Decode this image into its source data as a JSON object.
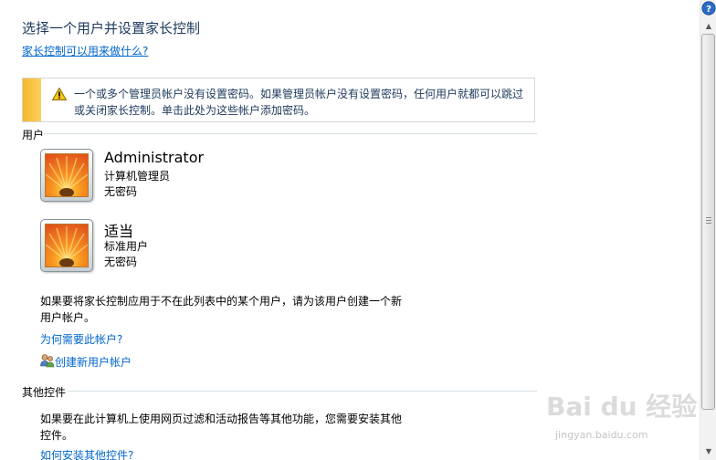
{
  "page": {
    "title": "选择一个用户并设置家长控制",
    "help_link": "家长控制可以用来做什么?"
  },
  "warning": {
    "line1": "一个或多个管理员帐户没有设置密码。如果管理员帐户没有设置密码，任何用户就都可以跳过",
    "line2": "或关闭家长控制。单击此处为这些帐户添加密码。",
    "icon": "warning-icon"
  },
  "users_section": {
    "label": "用户",
    "users": [
      {
        "name": "Administrator",
        "role": "计算机管理员",
        "password": "无密码"
      },
      {
        "name": "适当",
        "role": "标准用户",
        "password": "无密码"
      }
    ]
  },
  "info": {
    "line1": "如果要将家长控制应用于不在此列表中的某个用户，请为该用户创建一个新",
    "line2": "用户帐户。",
    "why_link": "为何需要此帐户?",
    "create_link": "创建新用户帐户"
  },
  "other_section": {
    "label": "其他控件",
    "line1": "如果要在此计算机上使用网页过滤和活动报告等其他功能，您需要安装其他",
    "line2": "控件。",
    "install_link": "如何安装其他控件?"
  },
  "watermark": {
    "text": "Bai du 经验",
    "sub": "jingyan.baidu.com"
  },
  "colors": {
    "title": "#1e395b",
    "link": "#0066cc",
    "warning_bar": "#f6b72b"
  }
}
